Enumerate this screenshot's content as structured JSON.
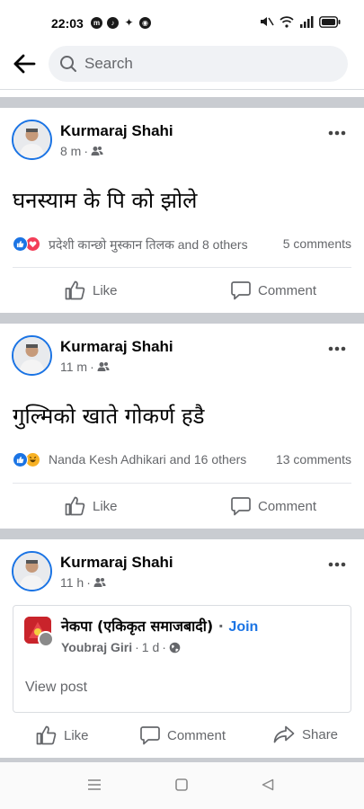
{
  "status": {
    "time": "22:03"
  },
  "search": {
    "placeholder": "Search"
  },
  "posts": [
    {
      "author": "Kurmaraj Shahi",
      "time": "8 m",
      "text": "घनस्याम के पि को झोले",
      "reactions": "प्रदेशी कान्छो मुस्कान तिलक and 8 others",
      "comments": "5 comments",
      "like_label": "Like",
      "comment_label": "Comment"
    },
    {
      "author": "Kurmaraj Shahi",
      "time": "11 m",
      "text": "गुल्मिको खाते गोकर्ण हडै",
      "reactions": "Nanda Kesh Adhikari and 16 others",
      "comments": "13 comments",
      "like_label": "Like",
      "comment_label": "Comment"
    },
    {
      "author": "Kurmaraj Shahi",
      "time": "11 h",
      "shared": {
        "group_name": "नेकपा (एकिकृत समाजबादी)",
        "join_label": "Join",
        "poster": "Youbraj Giri",
        "time": "1 d",
        "view_post": "View post"
      },
      "like_label": "Like",
      "comment_label": "Comment",
      "share_label": "Share"
    }
  ],
  "colors": {
    "accent": "#1b74e4",
    "separator": "#c9ccd1",
    "secondary_text": "#65676b"
  },
  "icons": [
    "back-arrow-icon",
    "search-icon",
    "more-icon",
    "friends-icon",
    "like-icon",
    "comment-icon",
    "share-icon",
    "globe-icon"
  ]
}
